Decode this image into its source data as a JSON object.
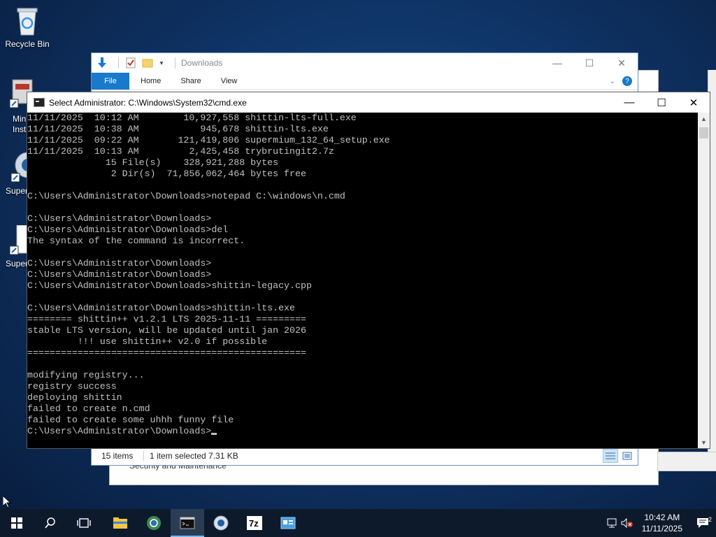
{
  "desktop": {
    "recycle_bin": "Recycle Bin",
    "icon2": "Min\nInst",
    "icon3": "Super",
    "icon4": "Super"
  },
  "bg_window": {
    "text": "Security and Maintenance"
  },
  "explorer": {
    "title": "Downloads",
    "tabs": [
      "File",
      "Home",
      "Share",
      "View"
    ],
    "status": {
      "items": "15 items",
      "selected": "1 item selected  7.31 KB"
    }
  },
  "cmd": {
    "title": "Select Administrator: C:\\Windows\\System32\\cmd.exe",
    "output": "11/11/2025  10:12 AM        10,927,558 shittin-lts-full.exe\n11/11/2025  10:38 AM           945,678 shittin-lts.exe\n11/11/2025  09:22 AM       121,419,806 supermium_132_64_setup.exe\n11/11/2025  10:13 AM         2,425,458 trybrutingit2.7z\n              15 File(s)    328,921,288 bytes\n               2 Dir(s)  71,856,062,464 bytes free\n\nC:\\Users\\Administrator\\Downloads>notepad C:\\windows\\n.cmd\n\nC:\\Users\\Administrator\\Downloads>\nC:\\Users\\Administrator\\Downloads>del\nThe syntax of the command is incorrect.\n\nC:\\Users\\Administrator\\Downloads>\nC:\\Users\\Administrator\\Downloads>\nC:\\Users\\Administrator\\Downloads>shittin-legacy.cpp\n\nC:\\Users\\Administrator\\Downloads>shittin-lts.exe\n======== shittin++ v1.2.1 LTS 2025-11-11 =========\nstable LTS version, will be updated until jan 2026\n         !!! use shittin++ v2.0 if possible\n==================================================\n\nmodifying registry...\nregistry success\ndeploying shittin\nfailed to create n.cmd\nfailed to create some uhhh funny file\n",
    "prompt": "C:\\Users\\Administrator\\Downloads>"
  },
  "taskbar": {
    "time": "10:42 AM",
    "date": "11/11/2025",
    "notifications": "2",
    "apps": [
      "start",
      "search",
      "task-view",
      "file-explorer",
      "supermium",
      "cmd",
      "7zip",
      "control-panel"
    ]
  }
}
